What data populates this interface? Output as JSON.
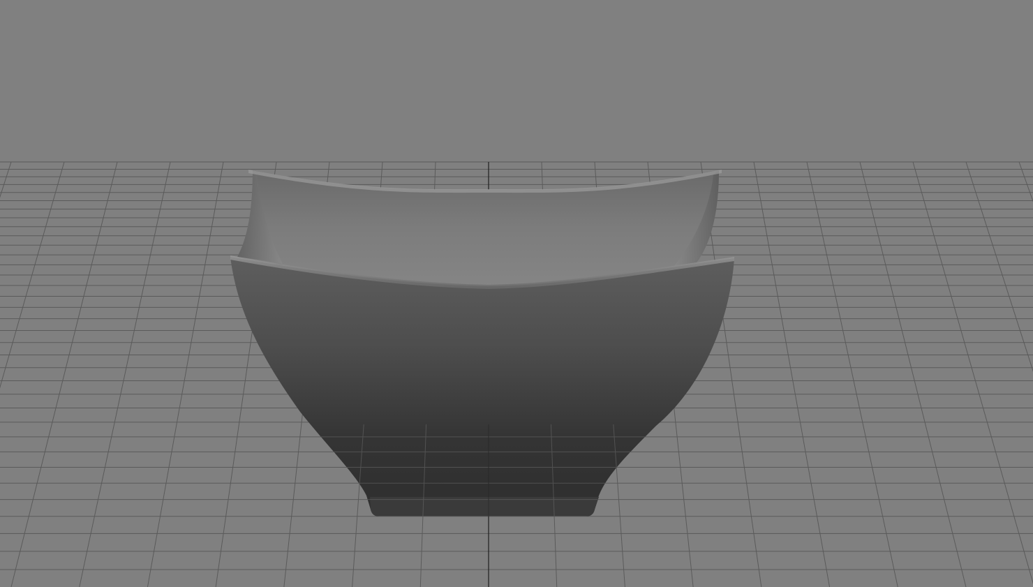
{
  "viewport": {
    "background_color": "#808080",
    "grid_color": "#5a5a5a",
    "grid_axis_color": "#1e1e1e",
    "model_base_color": "#6e6e6e"
  },
  "scene": {
    "object": "square-bowl",
    "icon": "bowl-model-icon",
    "grid": true
  }
}
